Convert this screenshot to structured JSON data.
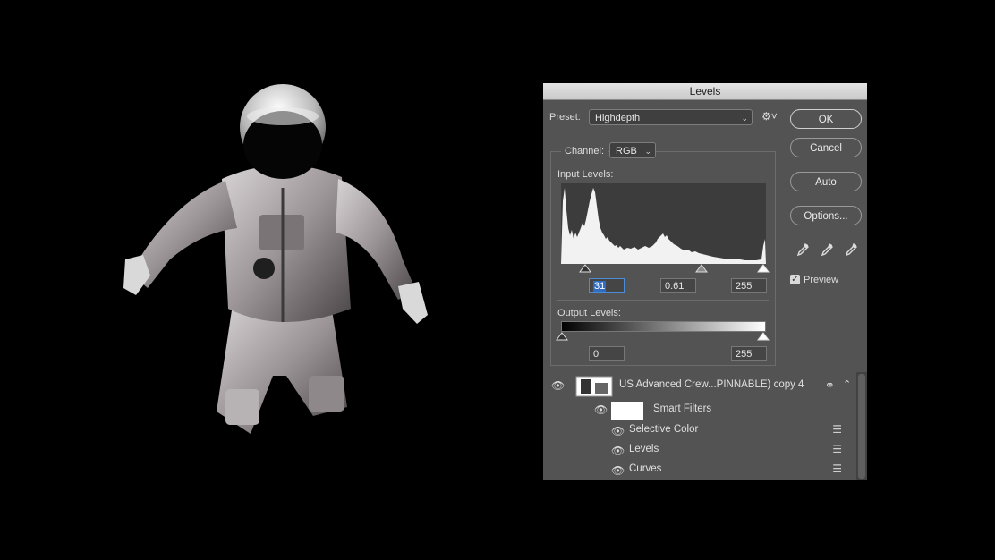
{
  "dialog": {
    "title": "Levels",
    "preset_label": "Preset:",
    "preset_value": "Highdepth",
    "channel_label": "Channel:",
    "channel_value": "RGB",
    "input_levels_label": "Input Levels:",
    "input_black": "31",
    "input_gamma": "0.61",
    "input_white": "255",
    "output_levels_label": "Output Levels:",
    "output_black": "0",
    "output_white": "255",
    "buttons": {
      "ok": "OK",
      "cancel": "Cancel",
      "auto": "Auto",
      "options": "Options..."
    },
    "preview_label": "Preview",
    "preview_checked": true
  },
  "layers": {
    "layer_name": "US Advanced Crew...PINNABLE) copy 4",
    "smart_filters_label": "Smart Filters",
    "filters": [
      "Selective Color",
      "Levels",
      "Curves"
    ]
  },
  "icons": [
    "eye-icon",
    "gear-icon",
    "eyedropper-icon",
    "filter-options-icon",
    "smart-object-icon",
    "chevron-up-icon"
  ]
}
